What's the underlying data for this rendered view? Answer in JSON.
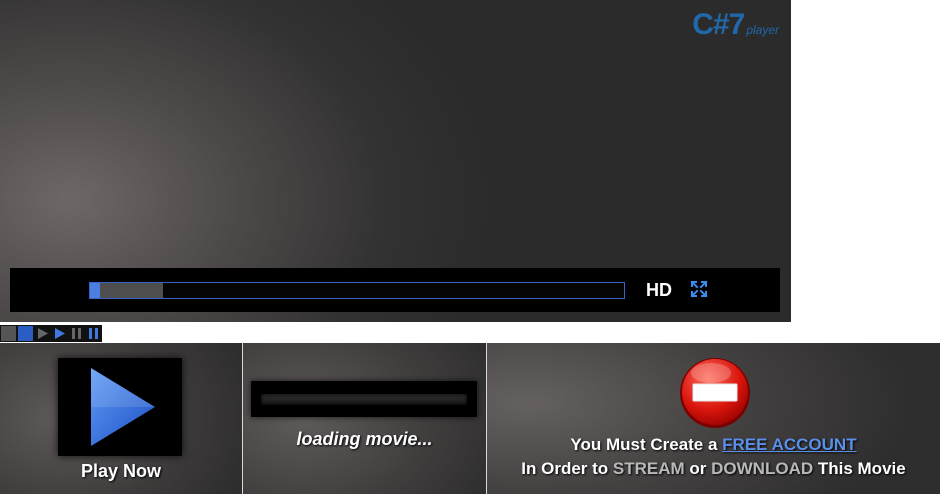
{
  "player": {
    "logo_main": "C#7",
    "logo_sub": "player",
    "hd_label": "HD",
    "progress": {
      "buffered": 0.137,
      "played": 0.019
    },
    "colors": {
      "accent": "#4b7ee0",
      "bar_bg": "#000000"
    }
  },
  "sprite_strip": [
    "sprite-gray",
    "sprite-blue",
    "play-icon-dark",
    "play-icon-blue",
    "pause-icon-dark",
    "pause-icon-blue"
  ],
  "panels": {
    "play": {
      "label": "Play Now"
    },
    "loading": {
      "label": "loading movie..."
    },
    "account": {
      "line1_prefix": "You Must Create a ",
      "line1_link": "FREE ACCOUNT",
      "line2_a": "In Order to ",
      "line2_stream": "STREAM",
      "line2_or": " or ",
      "line2_download": "DOWNLOAD",
      "line2_end": " This Movie"
    }
  }
}
